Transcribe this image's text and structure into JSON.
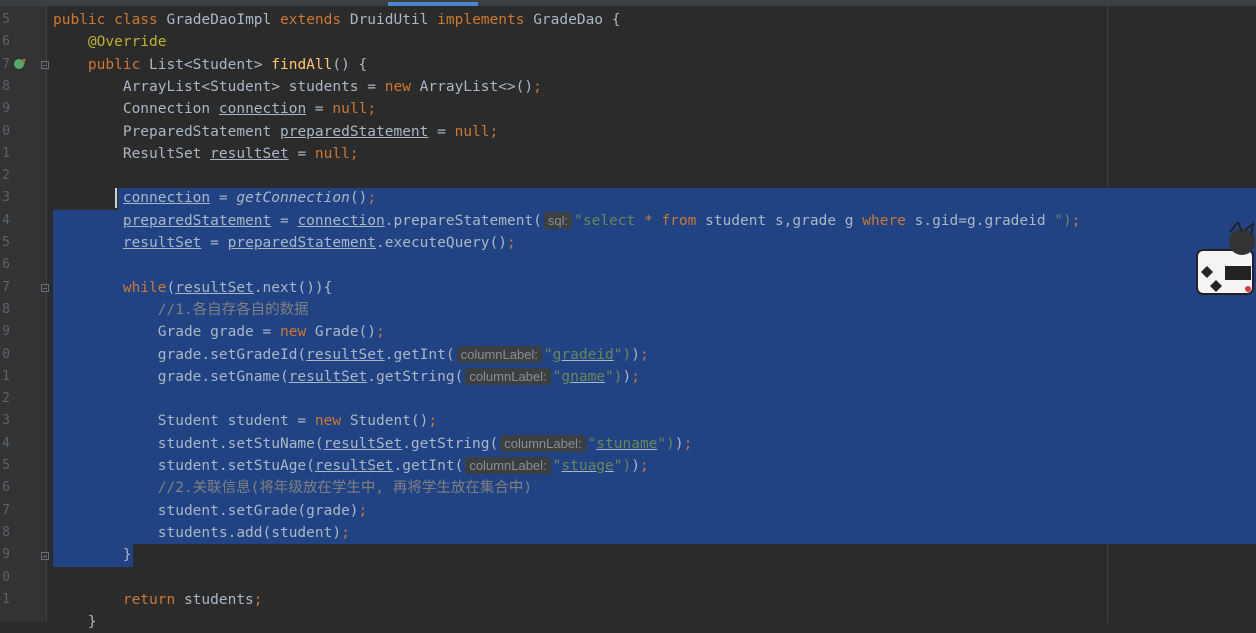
{
  "editor": {
    "line_numbers": [
      "5",
      "6",
      "7",
      "8",
      "9",
      "0",
      "1",
      "2",
      "3",
      "4",
      "5",
      "6",
      "7",
      "8",
      "9",
      "0",
      "1",
      "2",
      "3",
      "4",
      "5",
      "6",
      "7",
      "8",
      "9",
      "0",
      "1",
      ""
    ],
    "lines": [
      {
        "tokens": [
          {
            "t": "public class ",
            "c": "kw"
          },
          {
            "t": "GradeDaoImpl ",
            "c": ""
          },
          {
            "t": "extends ",
            "c": "kw"
          },
          {
            "t": "DruidUtil ",
            "c": ""
          },
          {
            "t": "implements ",
            "c": "kw"
          },
          {
            "t": "GradeDao {",
            "c": ""
          }
        ]
      },
      {
        "tokens": [
          {
            "t": "    ",
            "c": ""
          },
          {
            "t": "@Override",
            "c": "ann"
          }
        ]
      },
      {
        "tokens": [
          {
            "t": "    ",
            "c": ""
          },
          {
            "t": "public ",
            "c": "kw"
          },
          {
            "t": "List<Student> ",
            "c": ""
          },
          {
            "t": "findAll",
            "c": "fn"
          },
          {
            "t": "() {",
            "c": ""
          }
        ]
      },
      {
        "tokens": [
          {
            "t": "        ArrayList<Student> students = ",
            "c": ""
          },
          {
            "t": "new ",
            "c": "kw"
          },
          {
            "t": "ArrayList<>()",
            "c": ""
          },
          {
            "t": ";",
            "c": "kw"
          }
        ]
      },
      {
        "tokens": [
          {
            "t": "        Connection ",
            "c": ""
          },
          {
            "t": "connection",
            "c": "ul"
          },
          {
            "t": " = ",
            "c": ""
          },
          {
            "t": "null",
            "c": "kw"
          },
          {
            "t": ";",
            "c": "kw"
          }
        ]
      },
      {
        "tokens": [
          {
            "t": "        PreparedStatement ",
            "c": ""
          },
          {
            "t": "preparedStatement",
            "c": "ul"
          },
          {
            "t": " = ",
            "c": ""
          },
          {
            "t": "null",
            "c": "kw"
          },
          {
            "t": ";",
            "c": "kw"
          }
        ]
      },
      {
        "tokens": [
          {
            "t": "        ResultSet ",
            "c": ""
          },
          {
            "t": "resultSet",
            "c": "ul"
          },
          {
            "t": " = ",
            "c": ""
          },
          {
            "t": "null",
            "c": "kw"
          },
          {
            "t": ";",
            "c": "kw"
          }
        ]
      },
      {
        "tokens": []
      },
      {
        "tokens": [
          {
            "t": "        ",
            "c": ""
          },
          {
            "t": "connection",
            "c": "ul"
          },
          {
            "t": " = ",
            "c": ""
          },
          {
            "t": "getConnection",
            "c": "it"
          },
          {
            "t": "()",
            "c": ""
          },
          {
            "t": ";",
            "c": "kw"
          }
        ]
      },
      {
        "tokens": [
          {
            "t": "        ",
            "c": ""
          },
          {
            "t": "preparedStatement",
            "c": "ul"
          },
          {
            "t": " = ",
            "c": ""
          },
          {
            "t": "connection",
            "c": "ul"
          },
          {
            "t": ".prepareStatement(",
            "c": ""
          },
          {
            "t": "sql:",
            "c": "hint"
          },
          {
            "t": "\"select ",
            "c": "str"
          },
          {
            "t": "* ",
            "c": "kw"
          },
          {
            "t": "from ",
            "c": "kw"
          },
          {
            "t": "student s,grade g ",
            "c": ""
          },
          {
            "t": "where ",
            "c": "kw"
          },
          {
            "t": "s.gid=g.gradeid ",
            "c": ""
          },
          {
            "t": "\")",
            "c": "str"
          },
          {
            "t": ";",
            "c": "kw"
          }
        ]
      },
      {
        "tokens": [
          {
            "t": "        ",
            "c": ""
          },
          {
            "t": "resultSet",
            "c": "ul"
          },
          {
            "t": " = ",
            "c": ""
          },
          {
            "t": "preparedStatement",
            "c": "ul"
          },
          {
            "t": ".executeQuery()",
            "c": ""
          },
          {
            "t": ";",
            "c": "kw"
          }
        ]
      },
      {
        "tokens": []
      },
      {
        "tokens": [
          {
            "t": "        ",
            "c": ""
          },
          {
            "t": "while",
            "c": "kw"
          },
          {
            "t": "(",
            "c": ""
          },
          {
            "t": "resultSet",
            "c": "ul"
          },
          {
            "t": ".next()){",
            "c": ""
          }
        ]
      },
      {
        "tokens": [
          {
            "t": "            //1.各自存各自的数据",
            "c": "cmt"
          }
        ]
      },
      {
        "tokens": [
          {
            "t": "            Grade grade = ",
            "c": ""
          },
          {
            "t": "new ",
            "c": "kw"
          },
          {
            "t": "Grade()",
            "c": ""
          },
          {
            "t": ";",
            "c": "kw"
          }
        ]
      },
      {
        "tokens": [
          {
            "t": "            grade.setGradeId(",
            "c": ""
          },
          {
            "t": "resultSet",
            "c": "ul"
          },
          {
            "t": ".getInt(",
            "c": ""
          },
          {
            "t": "columnLabel:",
            "c": "hint"
          },
          {
            "t": "\"",
            "c": "str"
          },
          {
            "t": "gradeid",
            "c": "str ul"
          },
          {
            "t": "\")",
            "c": "str"
          },
          {
            "t": ")",
            "c": ""
          },
          {
            "t": ";",
            "c": "kw"
          }
        ]
      },
      {
        "tokens": [
          {
            "t": "            grade.setGname(",
            "c": ""
          },
          {
            "t": "resultSet",
            "c": "ul"
          },
          {
            "t": ".getString(",
            "c": ""
          },
          {
            "t": "columnLabel:",
            "c": "hint"
          },
          {
            "t": "\"",
            "c": "str"
          },
          {
            "t": "gname",
            "c": "str ul"
          },
          {
            "t": "\")",
            "c": "str"
          },
          {
            "t": ")",
            "c": ""
          },
          {
            "t": ";",
            "c": "kw"
          }
        ]
      },
      {
        "tokens": []
      },
      {
        "tokens": [
          {
            "t": "            Student student = ",
            "c": ""
          },
          {
            "t": "new ",
            "c": "kw"
          },
          {
            "t": "Student()",
            "c": ""
          },
          {
            "t": ";",
            "c": "kw"
          }
        ]
      },
      {
        "tokens": [
          {
            "t": "            student.setStuName(",
            "c": ""
          },
          {
            "t": "resultSet",
            "c": "ul"
          },
          {
            "t": ".getString(",
            "c": ""
          },
          {
            "t": "columnLabel:",
            "c": "hint"
          },
          {
            "t": "\"",
            "c": "str"
          },
          {
            "t": "stuname",
            "c": "str ul"
          },
          {
            "t": "\")",
            "c": "str"
          },
          {
            "t": ")",
            "c": ""
          },
          {
            "t": ";",
            "c": "kw"
          }
        ]
      },
      {
        "tokens": [
          {
            "t": "            student.setStuAge(",
            "c": ""
          },
          {
            "t": "resultSet",
            "c": "ul"
          },
          {
            "t": ".getInt(",
            "c": ""
          },
          {
            "t": "columnLabel:",
            "c": "hint"
          },
          {
            "t": "\"",
            "c": "str"
          },
          {
            "t": "stuage",
            "c": "str ul"
          },
          {
            "t": "\")",
            "c": "str"
          },
          {
            "t": ")",
            "c": ""
          },
          {
            "t": ";",
            "c": "kw"
          }
        ]
      },
      {
        "tokens": [
          {
            "t": "            //2.关联信息(将年级放在学生中, 再将学生放在集合中)",
            "c": "cmt"
          }
        ]
      },
      {
        "tokens": [
          {
            "t": "            student.setGrade(grade)",
            "c": ""
          },
          {
            "t": ";",
            "c": "kw"
          }
        ]
      },
      {
        "tokens": [
          {
            "t": "            students.add(student)",
            "c": ""
          },
          {
            "t": ";",
            "c": "kw"
          }
        ]
      },
      {
        "tokens": [
          {
            "t": "        }",
            "c": ""
          }
        ]
      },
      {
        "tokens": []
      },
      {
        "tokens": [
          {
            "t": "        ",
            "c": ""
          },
          {
            "t": "return ",
            "c": "kw"
          },
          {
            "t": "students",
            "c": ""
          },
          {
            "t": ";",
            "c": "kw"
          }
        ]
      },
      {
        "tokens": [
          {
            "t": "    }",
            "c": ""
          }
        ]
      }
    ]
  },
  "colors": {
    "background": "#2b2b2b",
    "selection": "#214283",
    "keyword": "#cc7832",
    "string": "#6a8759",
    "method_decl": "#ffc66d",
    "annotation": "#bbb529",
    "comment": "#808080"
  },
  "icons": {
    "gutter_override": "override-implements-icon",
    "sticker": "anime-sticker-icon"
  }
}
